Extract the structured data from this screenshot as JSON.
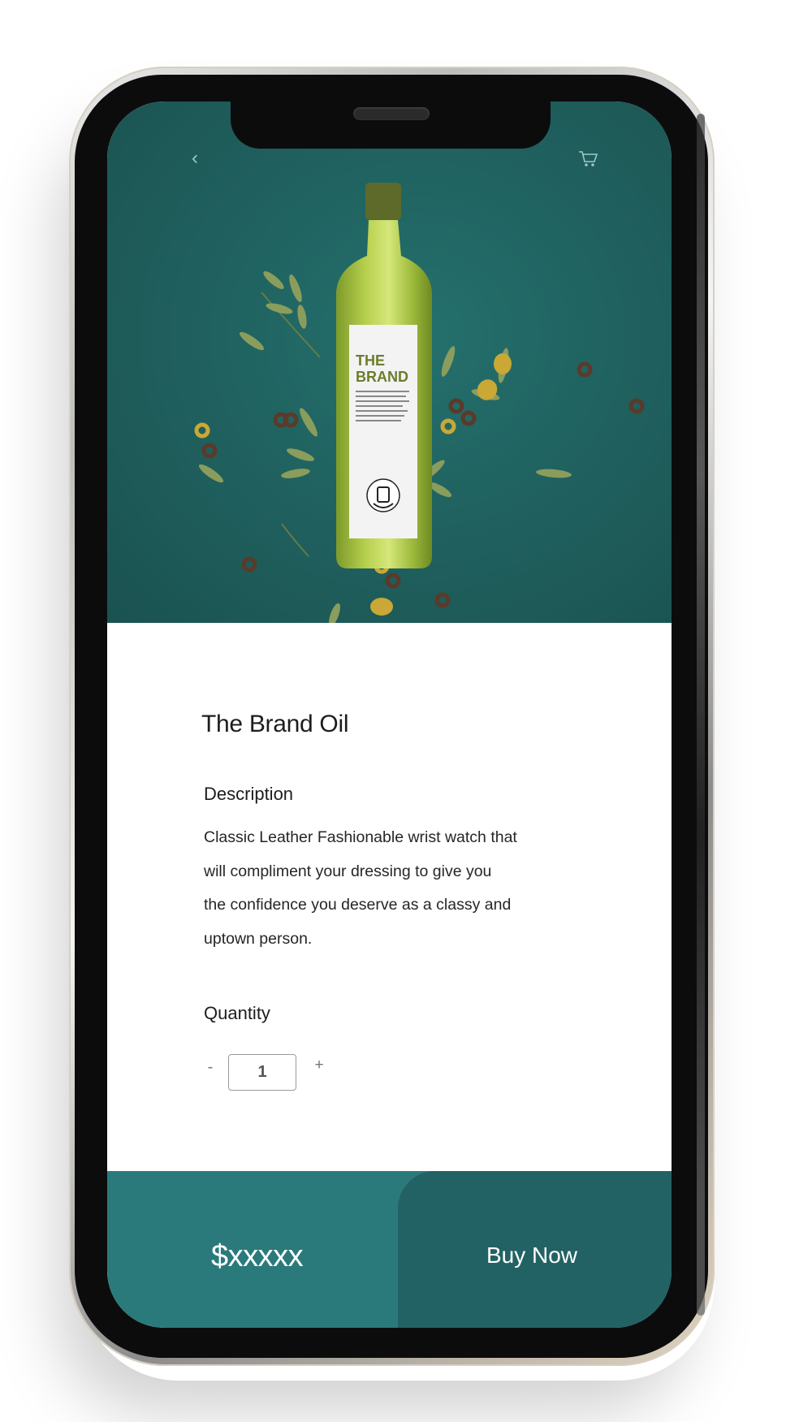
{
  "product": {
    "title": "The Brand Oil",
    "label_brand": "THE BRAND",
    "label_seal": "NFC TAP PHONE HERE"
  },
  "description": {
    "heading": "Description",
    "lines": [
      "Classic Leather Fashionable wrist watch that",
      "will compliment your dressing to give you",
      "the confidence you deserve as a classy and",
      "uptown person."
    ]
  },
  "quantity": {
    "heading": "Quantity",
    "minus_label": "-",
    "value": "1",
    "plus_label": "+"
  },
  "footer": {
    "price": "$xxxxx",
    "buy_label": "Buy Now"
  },
  "icons": {
    "back": "chevron-left-icon",
    "cart": "cart-icon"
  },
  "colors": {
    "hero_bg": "#1f5f5d",
    "price_bar": "#2a7a7b",
    "buy_button": "#236264"
  }
}
